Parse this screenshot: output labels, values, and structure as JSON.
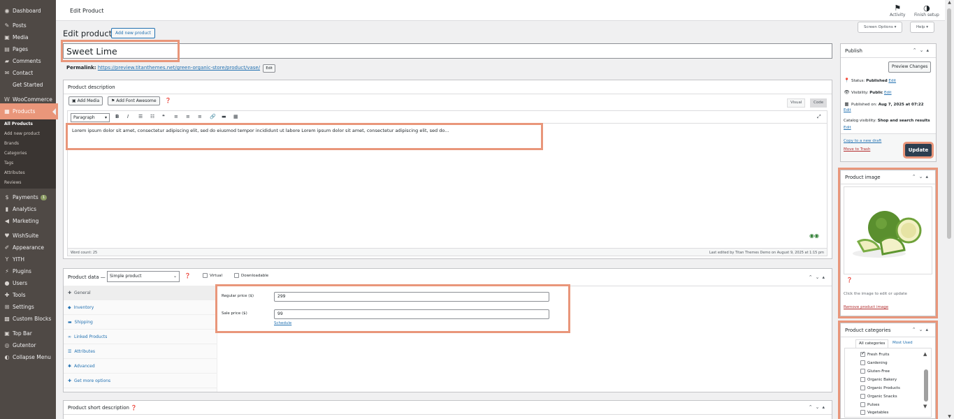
{
  "sidebar": {
    "items": [
      {
        "label": "Dashboard",
        "icon": "dashboard-icon"
      },
      {
        "label": "Posts",
        "icon": "pin-icon"
      },
      {
        "label": "Media",
        "icon": "media-icon"
      },
      {
        "label": "Pages",
        "icon": "page-icon"
      },
      {
        "label": "Comments",
        "icon": "comment-icon"
      },
      {
        "label": "Contact",
        "icon": "mail-icon"
      },
      {
        "label": "Get Started",
        "icon": ""
      },
      {
        "label": "WooCommerce",
        "icon": "woo-icon"
      },
      {
        "label": "Products",
        "icon": "products-icon"
      },
      {
        "label": "Payments",
        "icon": "payments-icon",
        "badge": "1"
      },
      {
        "label": "Analytics",
        "icon": "analytics-icon"
      },
      {
        "label": "Marketing",
        "icon": "megaphone-icon"
      },
      {
        "label": "WishSuite",
        "icon": "heart-icon"
      },
      {
        "label": "Appearance",
        "icon": "brush-icon"
      },
      {
        "label": "YITH",
        "icon": "yith-icon"
      },
      {
        "label": "Plugins",
        "icon": "plug-icon"
      },
      {
        "label": "Users",
        "icon": "user-icon"
      },
      {
        "label": "Tools",
        "icon": "wrench-icon"
      },
      {
        "label": "Settings",
        "icon": "settings-icon"
      },
      {
        "label": "Custom Blocks",
        "icon": "blocks-icon"
      },
      {
        "label": "Top Bar",
        "icon": "topbar-icon"
      },
      {
        "label": "Gutentor",
        "icon": "gutentor-icon"
      },
      {
        "label": "Collapse Menu",
        "icon": "collapse-icon"
      }
    ],
    "products_submenu": [
      "All Products",
      "Add new product",
      "Brands",
      "Categories",
      "Tags",
      "Attributes",
      "Reviews"
    ]
  },
  "topbar": {
    "title": "Edit Product",
    "activity": "Activity",
    "finish_setup": "Finish setup"
  },
  "header": {
    "page_title": "Edit product",
    "add_new": "Add new product",
    "screen_options": "Screen Options ▾",
    "help": "Help ▾"
  },
  "product": {
    "title": "Sweet Lime",
    "permalink_label": "Permalink:",
    "permalink_url": "https://preview.titanthemes.net/green-organic-store/product/vase/",
    "edit": "Edit"
  },
  "description": {
    "heading": "Product description",
    "add_media": "Add Media",
    "add_font_awesome": "Add Font Awesome",
    "visual_tab": "Visual",
    "code_tab": "Code",
    "format": "Paragraph",
    "body": "Lorem ipsum dolor sit amet, consectetur adipiscing elit, sed do eiusmod tempor incididunt ut labore Lorem ipsum dolor sit amet, consectetur adipiscing elit, sed do...",
    "word_count": "Word count: 25",
    "last_edited": "Last edited by Titan Themes Demo on August 9, 2025 at 1:15 pm"
  },
  "product_data": {
    "heading": "Product data —",
    "type": "Simple product",
    "virtual": "Virtual",
    "downloadable": "Downloadable",
    "tabs": [
      "General",
      "Inventory",
      "Shipping",
      "Linked Products",
      "Attributes",
      "Advanced",
      "Get more options"
    ],
    "regular_price_label": "Regular price ($)",
    "regular_price": "299",
    "sale_price_label": "Sale price ($)",
    "sale_price": "99",
    "schedule": "Schedule"
  },
  "short_description": {
    "heading": "Product short description"
  },
  "publish": {
    "heading": "Publish",
    "preview": "Preview Changes",
    "status_label": "Status:",
    "status": "Published",
    "visibility_label": "Visibility:",
    "visibility": "Public",
    "published_label": "Published on:",
    "published": "Aug 7, 2025 at 07:22",
    "catalog_label": "Catalog visibility:",
    "catalog": "Shop and search results",
    "edit": "Edit",
    "copy_draft": "Copy to a new draft",
    "trash": "Move to Trash",
    "update": "Update"
  },
  "product_image": {
    "heading": "Product image",
    "hint": "Click the image to edit or update",
    "remove": "Remove product image"
  },
  "categories": {
    "heading": "Product categories",
    "tab_all": "All categories",
    "tab_used": "Most Used",
    "items": [
      {
        "label": "Fresh Fruits",
        "checked": true
      },
      {
        "label": "Gardening",
        "checked": false
      },
      {
        "label": "Gluten-Free",
        "checked": false
      },
      {
        "label": "Organic Bakery",
        "checked": false
      },
      {
        "label": "Organic Products",
        "checked": false
      },
      {
        "label": "Organic Snacks",
        "checked": false
      },
      {
        "label": "Pulses",
        "checked": false
      },
      {
        "label": "Vegetables",
        "checked": false
      }
    ]
  },
  "colors": {
    "sidebar": "#4f4945",
    "highlight": "#e9967a",
    "link": "#2271b1",
    "update_button": "#2c3e50"
  }
}
